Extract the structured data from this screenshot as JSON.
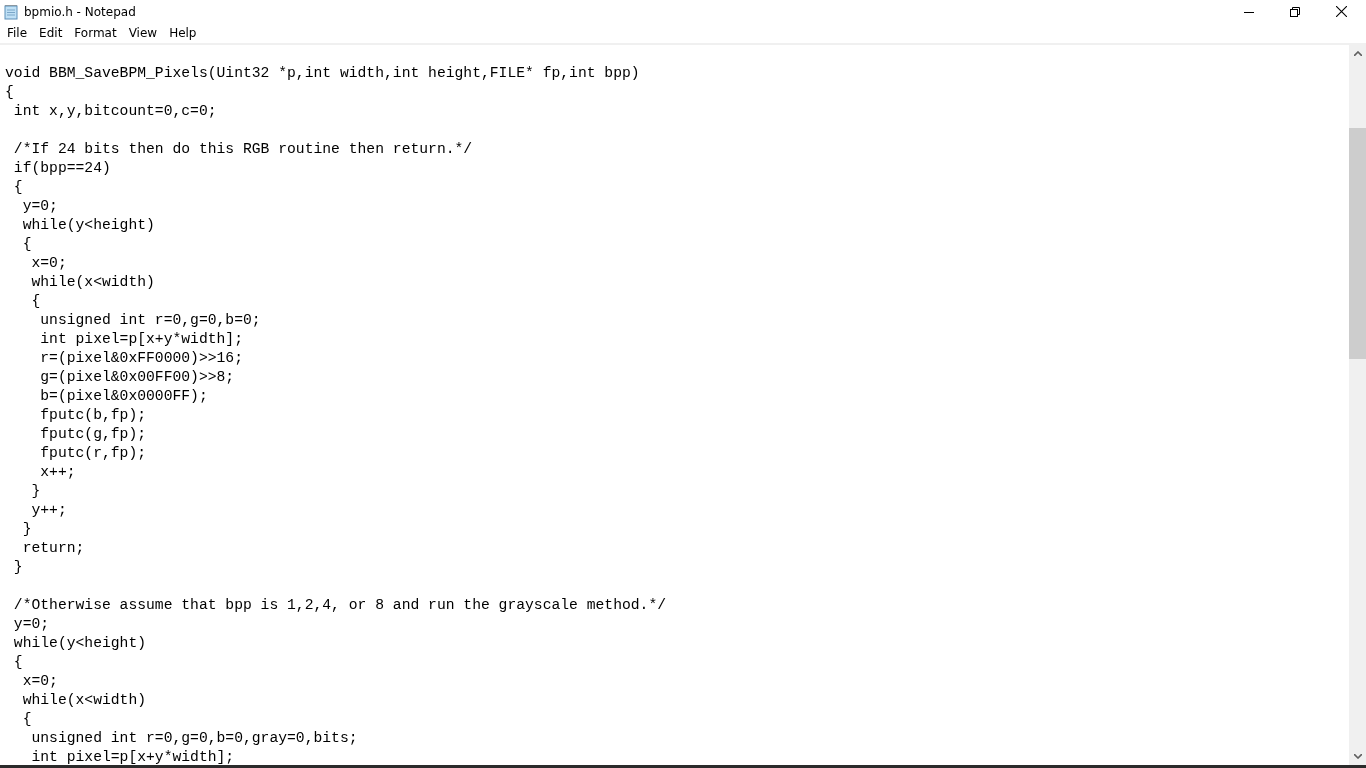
{
  "window": {
    "title": "bpmio.h - Notepad"
  },
  "menu": [
    "File",
    "Edit",
    "Format",
    "View",
    "Help"
  ],
  "editor": {
    "blocks": [
      [
        "void BBM_SaveBPM_Pixels(Uint32 *p,int width,int height,FILE* fp,int bpp)",
        "{",
        " int x,y,bitcount=0,c=0;"
      ],
      [
        " /*If 24 bits then do this RGB routine then return.*/",
        " if(bpp==24)",
        " {",
        "  y=0;",
        "  while(y<height)",
        "  {",
        "   x=0;",
        "   while(x<width)",
        "   {",
        "    unsigned int r=0,g=0,b=0;",
        "    int pixel=p[x+y*width];",
        "    r=(pixel&0xFF0000)>>16;",
        "    g=(pixel&0x00FF00)>>8;",
        "    b=(pixel&0x0000FF);",
        "    fputc(b,fp);",
        "    fputc(g,fp);",
        "    fputc(r,fp);",
        "    x++;",
        "   }",
        "   y++;",
        "  }",
        "  return;",
        " }"
      ],
      [
        " /*Otherwise assume that bpp is 1,2,4, or 8 and run the grayscale method.*/",
        " y=0;",
        " while(y<height)",
        " {",
        "  x=0;",
        "  while(x<width)",
        "  {",
        "   unsigned int r=0,g=0,b=0,gray=0,bits;",
        "   int pixel=p[x+y*width];"
      ]
    ]
  }
}
